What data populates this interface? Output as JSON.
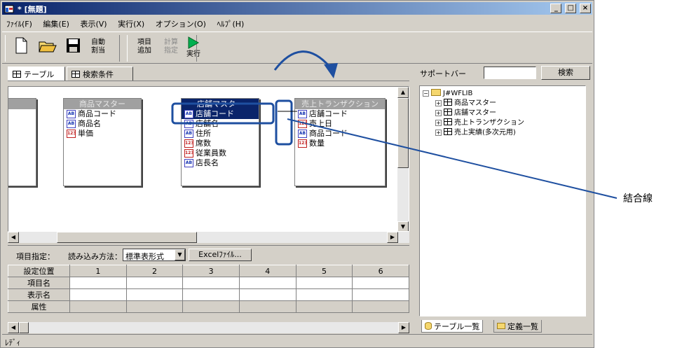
{
  "window": {
    "title": "* [無題]",
    "min": "_",
    "max": "□",
    "close": "×"
  },
  "menu": [
    "ﾌｧｲﾙ(F)",
    "編集(E)",
    "表示(V)",
    "実行(X)",
    "オプション(O)",
    "ﾍﾙﾌﾟ(H)"
  ],
  "toolbar": {
    "auto_assign": "自動\n割当",
    "add_item": "項目\n追加",
    "calc_assign": "計算\n指定",
    "run": "実行"
  },
  "tabs": {
    "table": "テーブル",
    "search": "検索条件"
  },
  "tables": [
    {
      "name": "",
      "fields": []
    },
    {
      "name": "商品マスター",
      "fields": [
        {
          "type": "AB",
          "name": "商品コード"
        },
        {
          "type": "AB",
          "name": "商品名"
        },
        {
          "type": "123",
          "name": "単価"
        }
      ]
    },
    {
      "name": "店舗マスター",
      "fields": [
        {
          "type": "AB",
          "name": "店舗コード"
        },
        {
          "type": "AB",
          "name": "店舗名"
        },
        {
          "type": "AB",
          "name": "住所"
        },
        {
          "type": "123",
          "name": "席数"
        },
        {
          "type": "123",
          "name": "従業員数"
        },
        {
          "type": "AB",
          "name": "店長名"
        }
      ]
    },
    {
      "name": "売上トランザクション",
      "fields": [
        {
          "type": "AB",
          "name": "店舗コード"
        },
        {
          "type": "123",
          "name": "売上日"
        },
        {
          "type": "AB",
          "name": "商品コード"
        },
        {
          "type": "123",
          "name": "数量"
        }
      ]
    }
  ],
  "field_bar": {
    "label": "項目指定：",
    "read_label": "読み込み方法：",
    "read_value": "標準表形式",
    "excel_button": "Excelﾌｧｲﾙ..."
  },
  "grid": {
    "header_label": "設定位置",
    "columns": [
      "1",
      "2",
      "3",
      "4",
      "5",
      "6"
    ],
    "rows": [
      "項目名",
      "表示名",
      "属性"
    ]
  },
  "status": "ﾚﾃﾞｨ",
  "support": {
    "label": "サポートバー",
    "search_button": "検索",
    "search_value": "",
    "tree_root": "J#WFLIB",
    "tree_items": [
      "商品マスター",
      "店舗マスター",
      "売上トランザクション",
      "売上実績(多次元用)"
    ],
    "tab_tables": "テーブル一覧",
    "tab_definitions": "定義一覧"
  },
  "annotation": "結合線",
  "colors": {
    "highlight": "#1e4fa0",
    "title_active": "#0a246a",
    "run_green": "#00b050"
  }
}
